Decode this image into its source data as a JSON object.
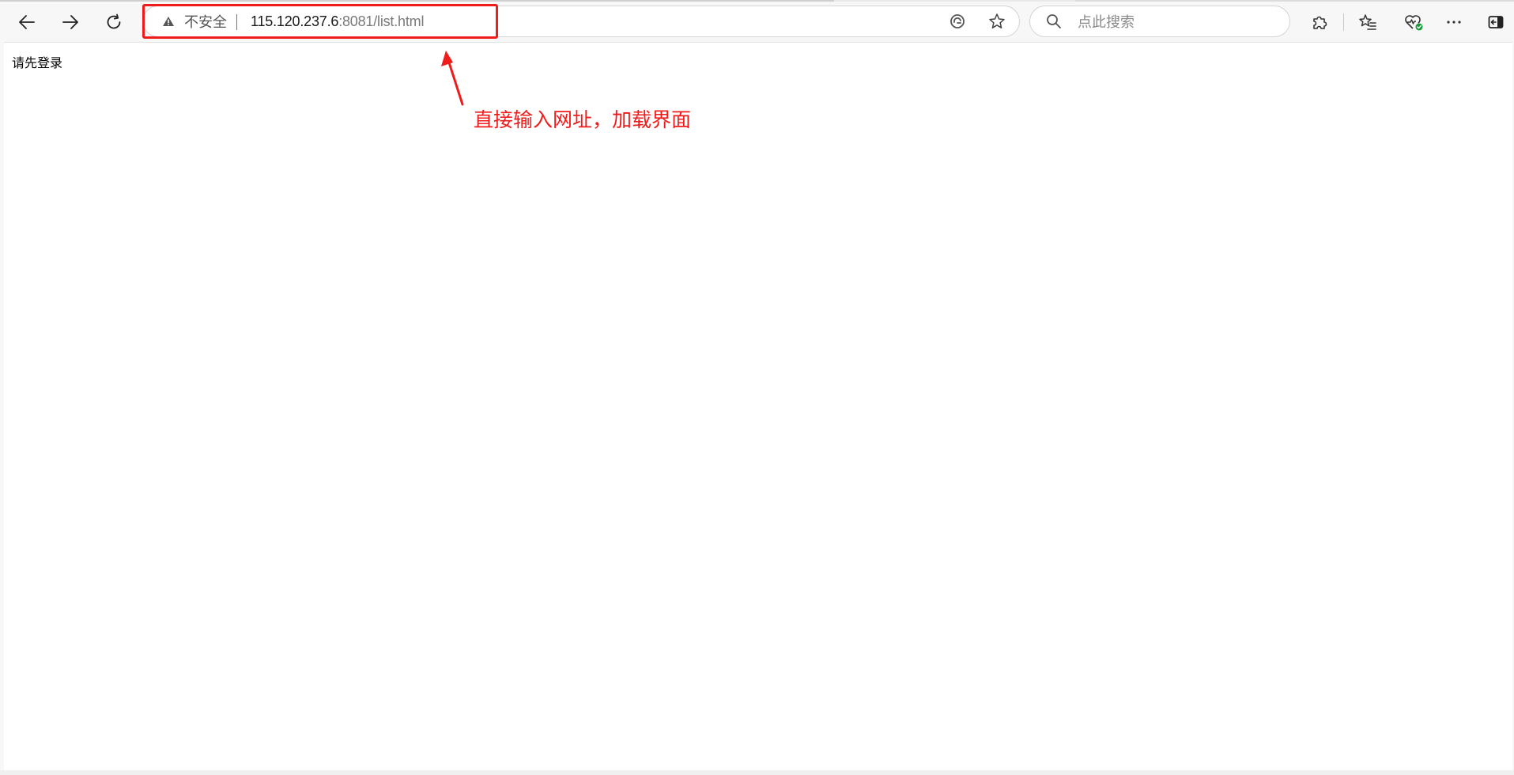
{
  "browser": {
    "address_bar": {
      "security_label": "不安全",
      "url_host": "115.120.237.6",
      "url_rest": ":8081/list.html"
    },
    "search": {
      "placeholder": "点此搜索"
    },
    "toolbar_icons": {
      "back": "back-arrow-icon",
      "forward": "forward-arrow-icon",
      "refresh": "refresh-icon",
      "read_aloud": "edge-refresh-icon",
      "favorite": "star-icon",
      "extensions": "puzzle-icon",
      "favorites": "favorites-list-icon",
      "performance": "heart-check-icon",
      "more": "more-icon",
      "sidebar": "sidebar-toggle-icon"
    }
  },
  "page": {
    "message": "请先登录"
  },
  "annotation": {
    "note": "直接输入网址，加载界面",
    "color": "#f01c1c"
  }
}
